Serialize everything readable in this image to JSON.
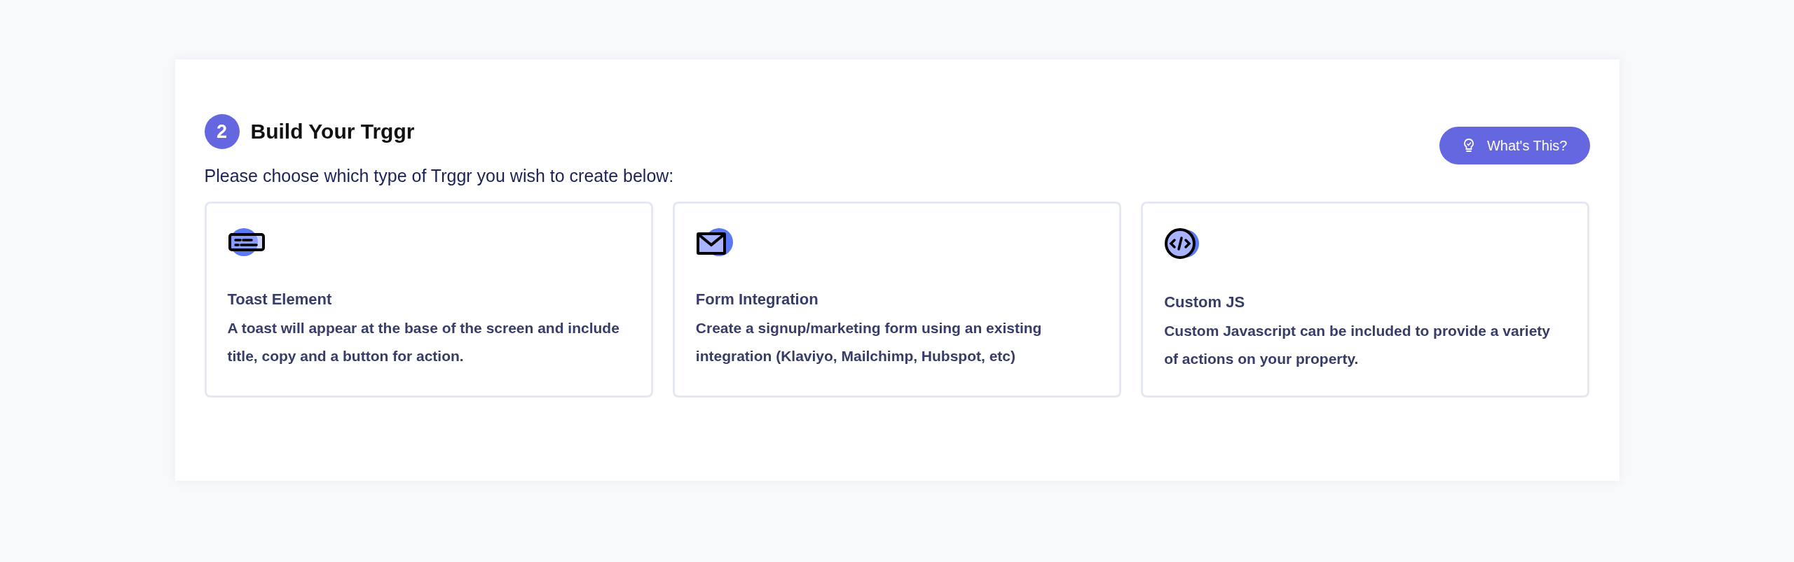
{
  "section": {
    "step": "2",
    "title": "Build Your Trggr",
    "help_button": "What's This?",
    "prompt": "Please choose which type of Trggr you wish to create below:"
  },
  "options": [
    {
      "kind": "toast",
      "title": "Toast Element",
      "description": "A toast will appear at the base of the screen and include title, copy and a button for action."
    },
    {
      "kind": "form",
      "title": "Form Integration",
      "description": "Create a signup/marketing form using an existing integration (Klaviyo, Mailchimp, Hubspot, etc)"
    },
    {
      "kind": "code",
      "title": "Custom JS",
      "description": "Custom Javascript can be included to provide a variety of actions on your property."
    }
  ]
}
